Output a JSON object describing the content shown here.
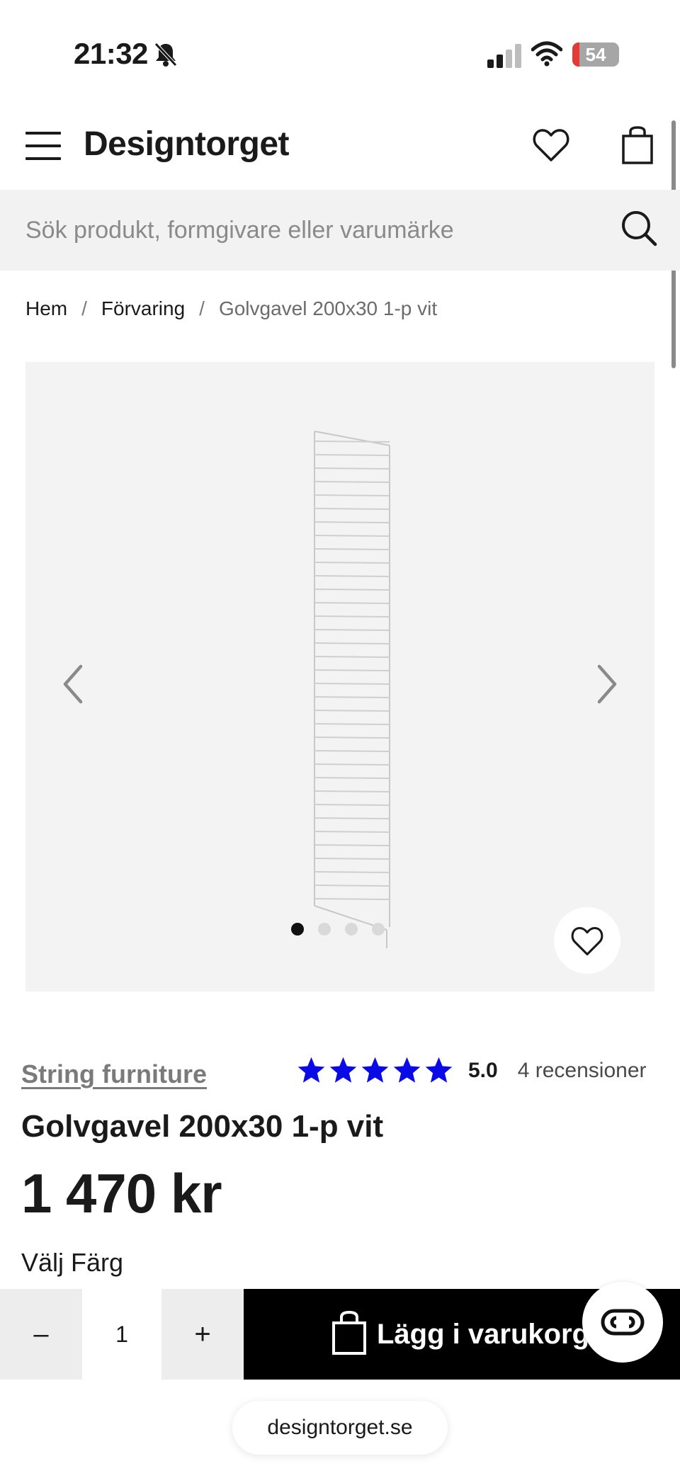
{
  "status_bar": {
    "time": "21:32",
    "battery_level": "54",
    "icons": [
      "bell-off-icon",
      "signal-icon",
      "wifi-icon",
      "battery-icon"
    ]
  },
  "header": {
    "logo": "Designtorget",
    "icons": [
      "menu-icon",
      "heart-icon",
      "shopping-bag-icon"
    ]
  },
  "search": {
    "placeholder": "Sök produkt, formgivare eller varumärke"
  },
  "breadcrumb": {
    "items": [
      "Hem",
      "Förvaring",
      "Golvgavel 200x30 1-p vit"
    ],
    "separator": "/"
  },
  "gallery": {
    "image_count": 4,
    "active_index": 0
  },
  "product": {
    "brand": "String furniture",
    "rating_value": "5.0",
    "rating_stars": 5,
    "reviews": "4 recensioner",
    "title": "Golvgavel 200x30 1-p vit",
    "price": "1 470 kr",
    "color_label": "Välj Färg"
  },
  "cart": {
    "quantity": "1",
    "minus": "–",
    "plus": "+",
    "add_label": "Lägg i varukorgen"
  },
  "browser": {
    "url": "designtorget.se"
  },
  "colors": {
    "star": "#0a0ae6",
    "cart_button": "#000000",
    "brand_link": "#7a7a7a"
  }
}
